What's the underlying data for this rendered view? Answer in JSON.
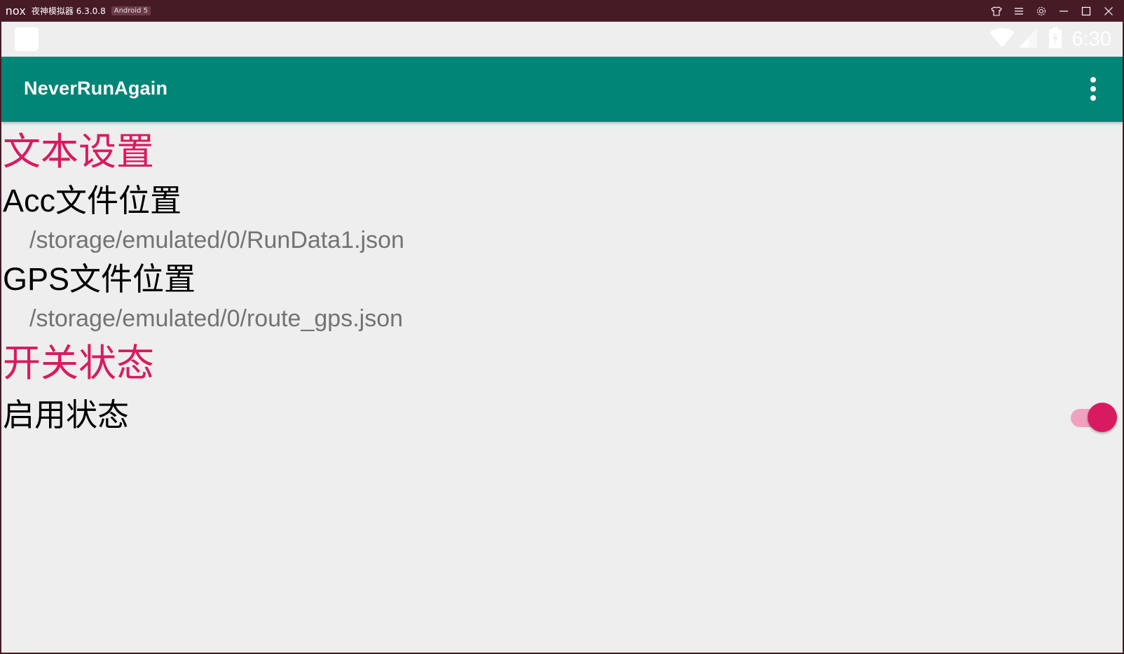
{
  "emulator": {
    "logo": "nox",
    "title": "夜神模拟器 6.3.0.8",
    "badge": "Android 5",
    "controls": [
      "shirt-icon",
      "menu-icon",
      "gear-icon",
      "minimize-icon",
      "maximize-icon",
      "close-icon"
    ]
  },
  "statusbar": {
    "time": "6:30",
    "icons": [
      "wifi-icon",
      "signal-icon",
      "battery-charging-icon"
    ]
  },
  "toolbar": {
    "title": "NeverRunAgain",
    "overflow_icon": "more-vert-icon"
  },
  "preferences": {
    "text_category": "文本设置",
    "acc_title": "Acc文件位置",
    "acc_summary": "/storage/emulated/0/RunData1.json",
    "gps_title": "GPS文件位置",
    "gps_summary": "/storage/emulated/0/route_gps.json",
    "switch_category": "开关状态",
    "enable_title": "启用状态",
    "enable_state": true
  },
  "colors": {
    "emulator_frame": "#471b26",
    "toolbar": "#008577",
    "accent": "#d81b60",
    "background": "#eeeeee",
    "summary_text": "#737373"
  }
}
